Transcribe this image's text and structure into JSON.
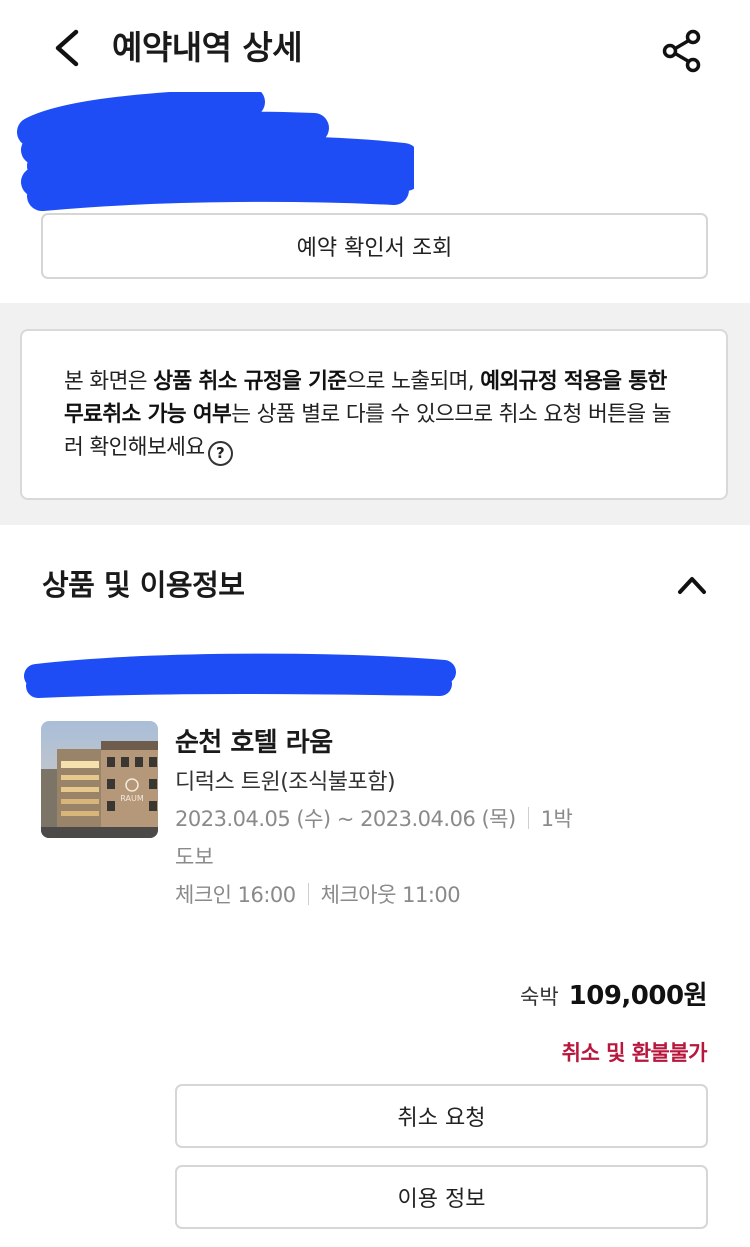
{
  "header": {
    "title": "예약내역 상세"
  },
  "confirm_button": "예약 확인서 조회",
  "notice": {
    "t1": "본 화면은 ",
    "b1": "상품 취소 규정을 기준",
    "t2": "으로 노출되며, ",
    "b2": "예외규정 적용을 통한 무료취소 가능 여부",
    "t3": "는 상품 별로 다를 수 있으므로 취소 요청 버튼을 눌러 확인해보세요",
    "help_glyph": "?"
  },
  "section": {
    "title": "상품 및 이용정보"
  },
  "product": {
    "hotel_name": "순천 호텔 라움",
    "room_type": "디럭스 트윈(조식불포함)",
    "dates": "2023.04.05 (수) ~ 2023.04.06 (목)",
    "nights": "1박",
    "access": "도보",
    "checkin": "체크인 16:00",
    "checkout": "체크아웃 11:00",
    "thumbnail_sign": "RAUM"
  },
  "price": {
    "label": "숙박",
    "value": "109,000원"
  },
  "refund_status": "취소 및 환불불가",
  "buttons": {
    "cancel": "취소 요청",
    "info": "이용 정보"
  },
  "colors": {
    "accent_red": "#b8163d",
    "redaction_blue": "#1f4df5",
    "band_gray": "#f1f1f1"
  }
}
